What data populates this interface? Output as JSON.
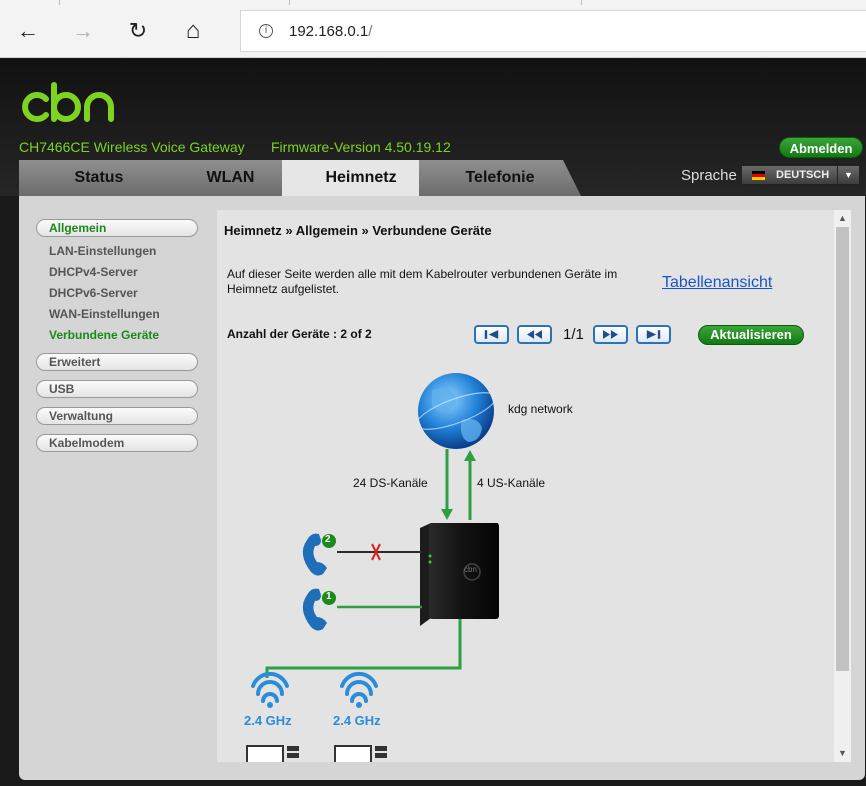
{
  "browser": {
    "back_icon": "←",
    "forward_icon": "→",
    "reload_icon": "↻",
    "home_icon": "⌂",
    "info_icon": "i",
    "url_host": "192.168.0.1",
    "url_path": "/"
  },
  "header": {
    "model": "CH7466CE  Wireless Voice Gateway",
    "firmware": "Firmware-Version  4.50.19.12",
    "logout_label": "Abmelden",
    "language_label": "Sprache",
    "language_value": "DEUTSCH",
    "tabs": [
      {
        "label": "Status"
      },
      {
        "label": "WLAN"
      },
      {
        "label": "Heimnetz"
      },
      {
        "label": "Telefonie"
      }
    ]
  },
  "sidebar": {
    "sections": [
      {
        "label": "Allgemein",
        "items": [
          "LAN-Einstellungen",
          "DHCPv4-Server",
          "DHCPv6-Server",
          "WAN-Einstellungen",
          "Verbundene Geräte"
        ]
      },
      {
        "label": "Erweitert"
      },
      {
        "label": "USB"
      },
      {
        "label": "Verwaltung"
      },
      {
        "label": "Kabelmodem"
      }
    ]
  },
  "main": {
    "breadcrumb": "Heimnetz » Allgemein » Verbundene Geräte",
    "description": "Auf dieser Seite werden alle mit dem Kabelrouter verbundenen Geräte im Heimnetz aufgelistet.",
    "table_view_link": "Tabellenansicht",
    "device_count": "Anzahl der Geräte : 2 of 2",
    "page": "1/1",
    "refresh_label": "Aktualisieren",
    "diagram": {
      "network_label": "kdg network",
      "ds_label": "24 DS-Kanäle",
      "us_label": "4 US-Kanäle",
      "phone_2": "2",
      "phone_1": "1",
      "wifi_1": "2.4 GHz",
      "wifi_2": "2.4 GHz",
      "router_logo": "cbn"
    }
  },
  "colors": {
    "brand_green": "#7ed321",
    "button_green": "#137a13",
    "link_blue": "#1a55c8",
    "wifi_blue": "#2b8cd8",
    "line_green": "#2ea043",
    "disconnected_red": "#e02020"
  }
}
